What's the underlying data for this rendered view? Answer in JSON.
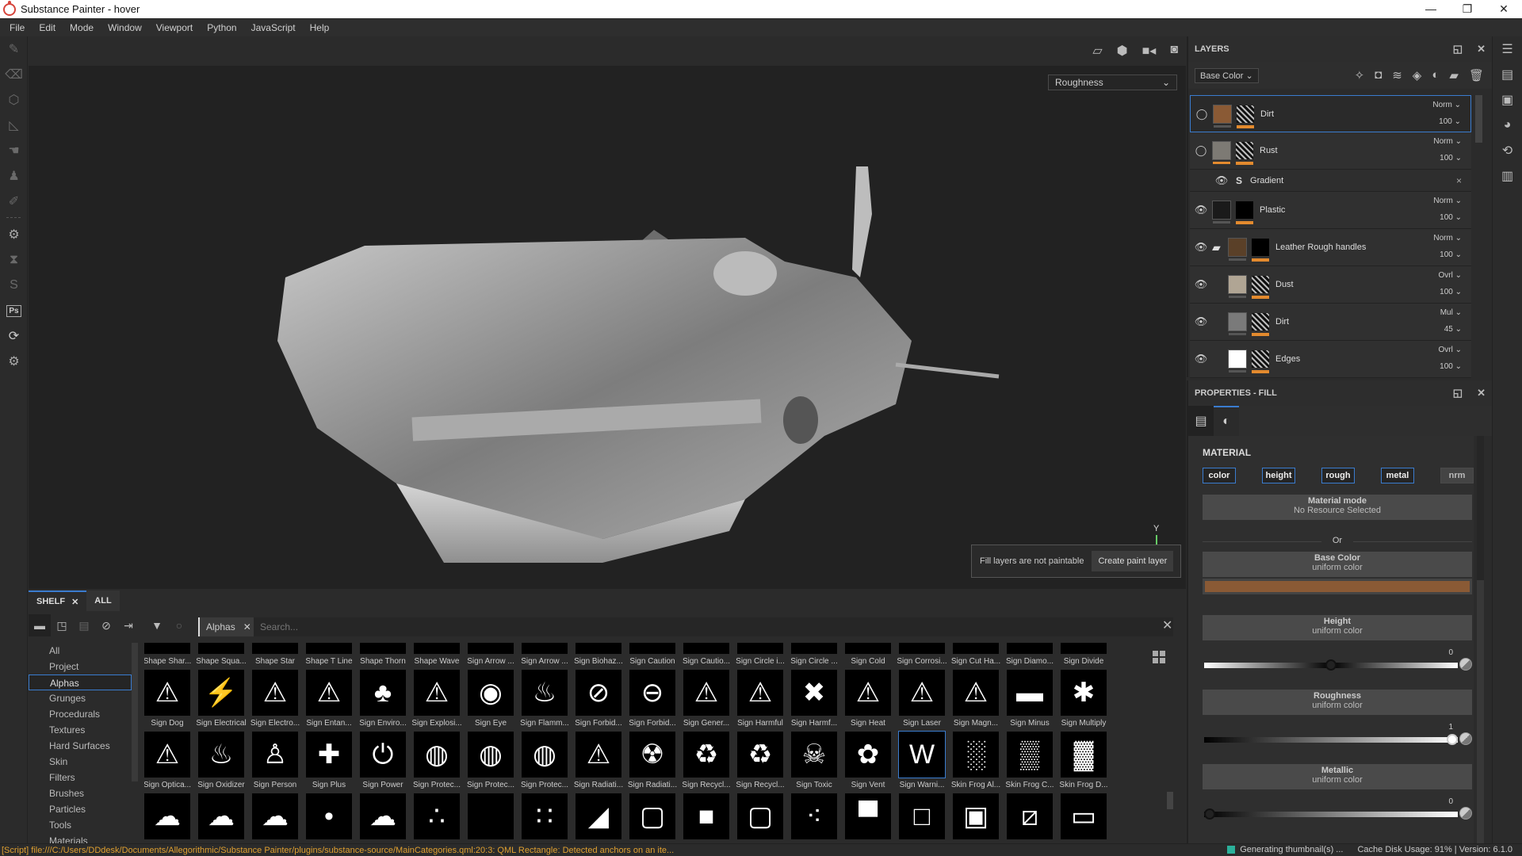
{
  "window": {
    "title": "Substance Painter - hover",
    "minimize": "—",
    "restore": "❐",
    "close": "✕"
  },
  "menu": [
    "File",
    "Edit",
    "Mode",
    "Window",
    "Viewport",
    "Python",
    "JavaScript",
    "Help"
  ],
  "viewport": {
    "channel_select": "Roughness",
    "axis_label": "Y",
    "notice": {
      "message": "Fill layers are not paintable",
      "button": "Create paint layer"
    }
  },
  "layers": {
    "title": "LAYERS",
    "channel": "Base Color",
    "items": [
      {
        "name": "Dirt",
        "blend": "Norm",
        "opacity": "100",
        "color": "#8a5a35",
        "active": true,
        "mask": "noise"
      },
      {
        "name": "Rust",
        "blend": "Norm",
        "opacity": "100",
        "color": "#7d7a74",
        "mask": "noise"
      },
      {
        "name": "Gradient",
        "sub": true
      },
      {
        "name": "Plastic",
        "blend": "Norm",
        "opacity": "100",
        "color": "#1a1a1a",
        "mask": "black"
      },
      {
        "name": "Leather Rough handles",
        "blend": "Norm",
        "opacity": "100",
        "color": "#5a4028",
        "folder": true,
        "mask": "black"
      },
      {
        "name": "Dust",
        "blend": "Ovrl",
        "opacity": "100",
        "color": "#b0a594",
        "mask": "noise",
        "indent": true
      },
      {
        "name": "Dirt",
        "blend": "Mul",
        "opacity": "45",
        "color": "#7a7a7a",
        "mask": "noise",
        "indent": true
      },
      {
        "name": "Edges",
        "blend": "Ovrl",
        "opacity": "100",
        "color": "#ffffff",
        "mask": "noise",
        "indent": true
      }
    ]
  },
  "properties": {
    "title": "PROPERTIES - FILL",
    "section": "MATERIAL",
    "chips": [
      {
        "label": "color",
        "on": true
      },
      {
        "label": "height",
        "on": true
      },
      {
        "label": "rough",
        "on": true
      },
      {
        "label": "metal",
        "on": true
      },
      {
        "label": "nrm",
        "on": false
      }
    ],
    "material_mode": {
      "title": "Material mode",
      "sub": "No Resource Selected"
    },
    "or": "Or",
    "base_color": {
      "title": "Base Color",
      "sub": "uniform color",
      "value": "#8a5a35"
    },
    "height": {
      "title": "Height",
      "sub": "uniform color",
      "value": "0",
      "fraction": 0.5
    },
    "roughness": {
      "title": "Roughness",
      "sub": "uniform color",
      "value": "1",
      "fraction": 1.0
    },
    "metallic": {
      "title": "Metallic",
      "sub": "uniform color",
      "value": "0",
      "fraction": 0.0
    }
  },
  "shelf": {
    "tabs": [
      "SHELF",
      "ALL"
    ],
    "filter_tag": "Alphas",
    "search_placeholder": "Search...",
    "categories": [
      "All",
      "Project",
      "Alphas",
      "Grunges",
      "Procedurals",
      "Textures",
      "Hard Surfaces",
      "Skin",
      "Filters",
      "Brushes",
      "Particles",
      "Tools",
      "Materials"
    ],
    "selected_category": "Alphas",
    "rows": [
      [
        "Shape Shar...",
        "Shape Squa...",
        "Shape Star",
        "Shape T Line",
        "Shape Thorn",
        "Shape Wave",
        "Sign Arrow ...",
        "Sign Arrow ...",
        "Sign Biohaz...",
        "Sign Caution",
        "Sign Cautio...",
        "Sign Circle i...",
        "Sign Circle ...",
        "Sign Cold",
        "Sign Corrosi...",
        "Sign Cut Ha...",
        "Sign Diamo...",
        "Sign Divide"
      ],
      [
        "Sign Dog",
        "Sign Electrical",
        "Sign Electro...",
        "Sign Entan...",
        "Sign Enviro...",
        "Sign Explosi...",
        "Sign Eye",
        "Sign Flamm...",
        "Sign Forbid...",
        "Sign Forbid...",
        "Sign Gener...",
        "Sign Harmful",
        "Sign Harmf...",
        "Sign Heat",
        "Sign Laser",
        "Sign Magn...",
        "Sign Minus",
        "Sign Multiply"
      ],
      [
        "Sign Optica...",
        "Sign Oxidizer",
        "Sign Person",
        "Sign Plus",
        "Sign Power",
        "Sign Protec...",
        "Sign Protec...",
        "Sign Protec...",
        "Sign Radiati...",
        "Sign Radiati...",
        "Sign Recycl...",
        "Sign Recycl...",
        "Sign Toxic",
        "Sign Vent",
        "Sign Warni...",
        "Skin Frog Al...",
        "Skin Frog C...",
        "Skin Frog D..."
      ]
    ],
    "glyphs": [
      [
        "",
        "",
        "",
        "",
        "",
        "",
        "",
        "",
        "",
        "",
        "",
        "",
        "",
        "",
        "",
        "",
        "",
        ""
      ],
      [
        "⚠",
        "⚡",
        "⚠",
        "⚠",
        "♣",
        "⚠",
        "◉",
        "♨",
        "⊘",
        "⊖",
        "⚠",
        "⚠",
        "✖",
        "⚠",
        "⚠",
        "⚠",
        "▬",
        "✱"
      ],
      [
        "⚠",
        "♨",
        "♙",
        "✚",
        "⏻",
        "◍",
        "◍",
        "◍",
        "⚠",
        "☢",
        "♻",
        "♻",
        "☠",
        "✿",
        "W",
        "░",
        "▒",
        "▓"
      ],
      [
        "☁",
        "☁",
        "☁",
        "•",
        "☁",
        "∴",
        "",
        "∷",
        "◢",
        "▢",
        "■",
        "▢",
        "⁖",
        "▀",
        "□",
        "▣",
        "⧄",
        "▭"
      ]
    ],
    "selected_item": "Sign Warni..."
  },
  "status": {
    "script": "[Script] file:///C:/Users/DDdesk/Documents/Allegorithmic/Substance Painter/plugins/substance-source/MainCategories.qml:20:3: QML Rectangle: Detected anchors on an ite...",
    "generating": "Generating thumbnail(s) ...",
    "cache": "Cache Disk Usage:",
    "cache_value": "91%",
    "version": "Version: 6.1.0"
  }
}
